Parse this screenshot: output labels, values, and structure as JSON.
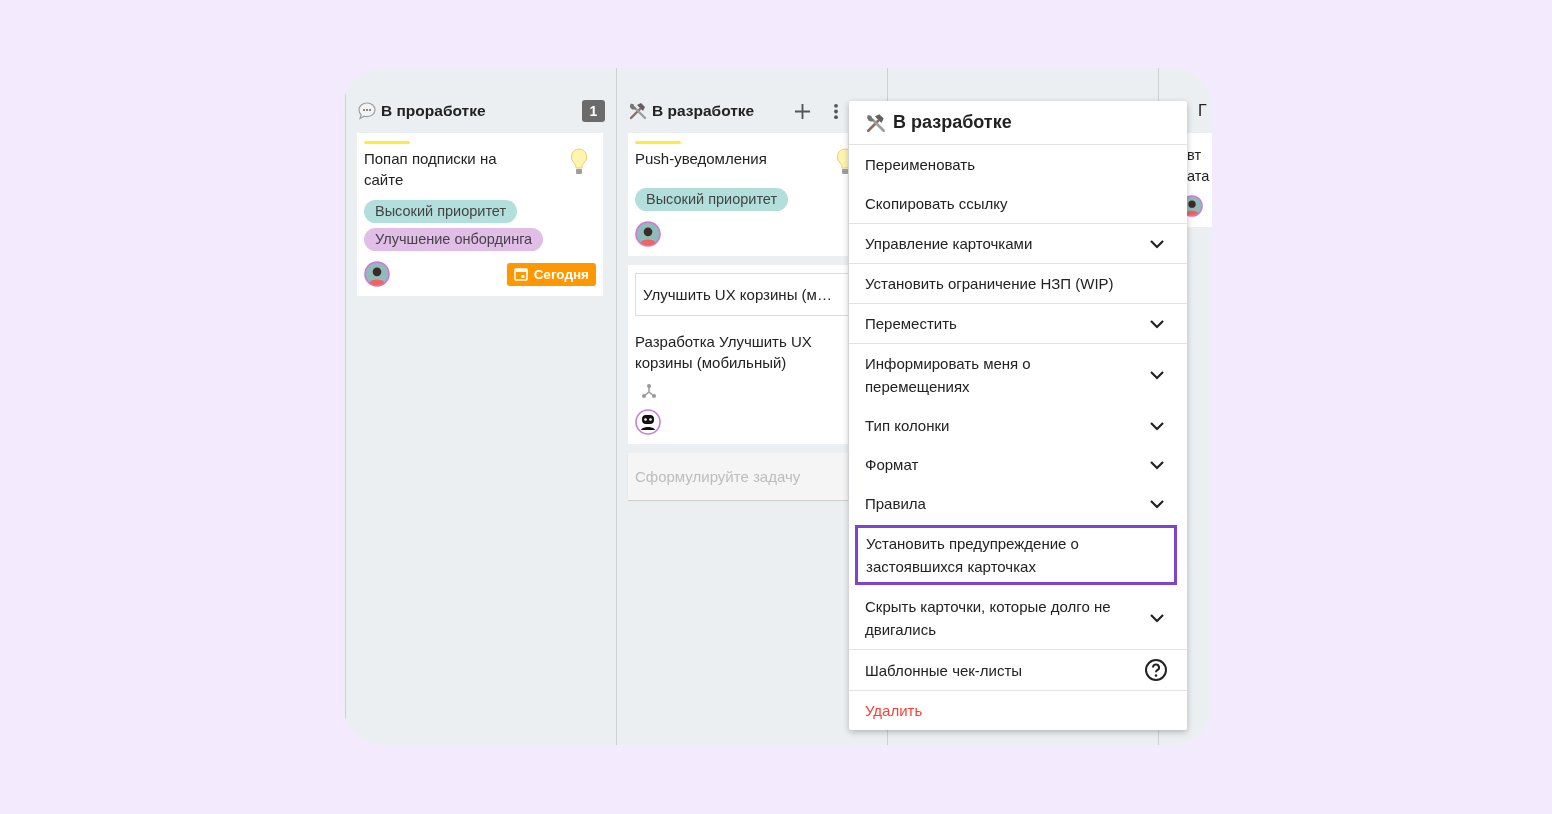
{
  "board": {
    "columns": [
      {
        "kind": "column",
        "title": "В проработке",
        "count": "1",
        "actions": false,
        "cards": [
          {
            "kind": "task",
            "color": "#ffeb3b",
            "title": "Попап подписки на сайте",
            "idea": true,
            "tags": [
              {
                "label": "Высокий приоритет",
                "color": "#b2dfdb"
              },
              {
                "label": "Улучшение онбординга",
                "color": "#e1bee7"
              }
            ],
            "due": "Сегодня"
          }
        ]
      },
      {
        "kind": "column",
        "title": "В разработке",
        "actions": true,
        "cards": [
          {
            "kind": "task",
            "color": "#ffeb3b",
            "title": "Push-уведомления",
            "idea": true,
            "tags": [
              {
                "label": "Высокий приоритет",
                "color": "#b2dfdb"
              }
            ]
          },
          {
            "kind": "subtask",
            "parent": "Улучшить UX корзины (м…",
            "title": "Разработка Улучшить UX корзины (мобильный)"
          }
        ],
        "new_task": {
          "placeholder": "Сформулируйте задачу"
        }
      },
      {
        "kind": "column"
      },
      {
        "kind": "partial",
        "title": "Г",
        "cards": [
          {
            "kind": "partial",
            "lines": [
              "вт",
              "ата"
            ]
          }
        ]
      }
    ]
  },
  "menu": {
    "title": "В разработке",
    "groups": [
      {
        "items": [
          {
            "label": "Переименовать",
            "kind": "plain",
            "highlighted": false
          },
          {
            "label": "Скопировать ссылку",
            "kind": "plain",
            "highlighted": false
          }
        ]
      },
      {
        "items": [
          {
            "label": "Управление карточками",
            "kind": "submenu",
            "highlighted": false
          }
        ]
      },
      {
        "items": [
          {
            "label": "Установить ограничение НЗП (WIP)",
            "kind": "plain",
            "highlighted": false
          }
        ]
      },
      {
        "items": [
          {
            "label": "Переместить",
            "kind": "submenu",
            "highlighted": false
          }
        ]
      },
      {
        "items": [
          {
            "label": "Информировать меня о перемещениях",
            "kind": "submenu",
            "highlighted": false
          },
          {
            "label": "Тип колонки",
            "kind": "submenu",
            "highlighted": false
          },
          {
            "label": "Формат",
            "kind": "submenu",
            "highlighted": false
          },
          {
            "label": "Правила",
            "kind": "submenu",
            "highlighted": false
          },
          {
            "label": "Установить предупреждение о застоявшихся карточках",
            "kind": "plain",
            "highlighted": true
          },
          {
            "label": "Скрыть карточки, которые долго не двигались",
            "kind": "submenu",
            "highlighted": false
          }
        ]
      },
      {
        "items": [
          {
            "label": "Шаблонные чек-листы",
            "kind": "help",
            "highlighted": false
          }
        ]
      },
      {
        "items": [
          {
            "label": "Удалить",
            "kind": "danger",
            "highlighted": false
          }
        ]
      }
    ]
  }
}
